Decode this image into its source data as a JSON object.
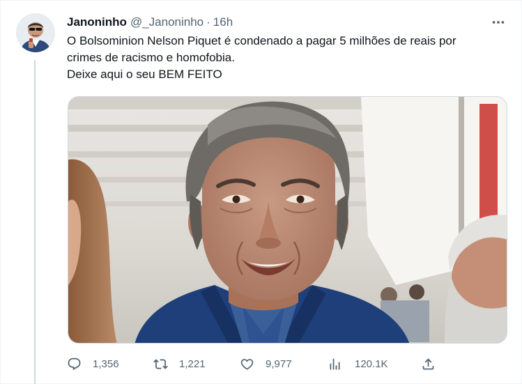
{
  "tweet": {
    "author": {
      "name": "Janoninho",
      "handle": "@_Janoninho",
      "separator": "·",
      "time": "16h"
    },
    "text_lines": [
      "O Bolsominion Nelson Piquet é condenado a pagar 5 milhões de reais por",
      "crimes de racismo e homofobia.",
      "Deixe aqui o seu BEM FEITO"
    ],
    "media": {
      "subject": "photo of smiling grey-haired man in navy blazer"
    },
    "stats": {
      "replies": "1,356",
      "retweets": "1,221",
      "likes": "9,977",
      "views": "120.1K"
    }
  },
  "icons": {
    "more": "more-horizontal-icon",
    "reply": "reply-icon",
    "retweet": "retweet-icon",
    "like": "heart-icon",
    "views": "views-icon",
    "share": "share-icon"
  },
  "colors": {
    "text_primary": "#0f1419",
    "text_secondary": "#536471",
    "thread_line": "#cfd9de",
    "blazer": "#1f3f7a"
  }
}
